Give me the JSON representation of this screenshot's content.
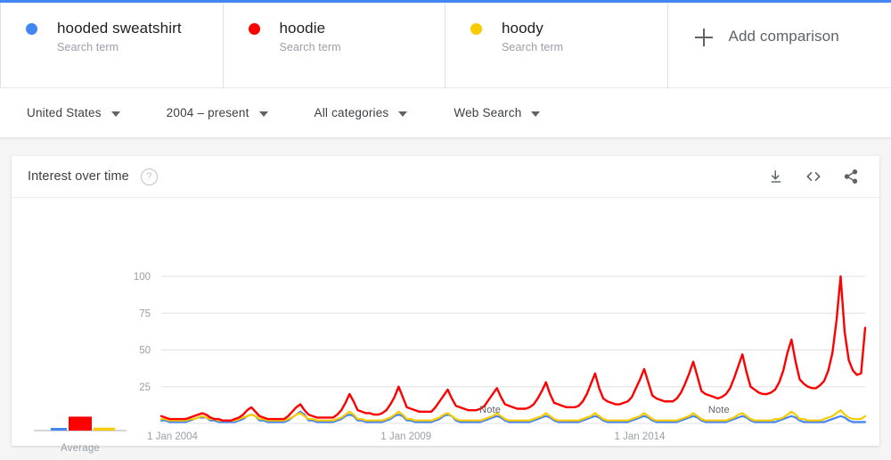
{
  "theme": {
    "accent": "#4285f4",
    "series_colors": [
      "#4285f4",
      "#fe0000",
      "#f8ca00"
    ],
    "page_bg": "#f5f5f5",
    "card_bg": "#ffffff",
    "text_primary": "#202124",
    "text_secondary": "#5f6368",
    "text_muted": "#9aa0a6",
    "grid": "#e0e0e0"
  },
  "terms": [
    {
      "name": "hooded sweatshirt",
      "subtitle": "Search term",
      "color": "#4285f4",
      "dot": "series-dot-blue"
    },
    {
      "name": "hoodie",
      "subtitle": "Search term",
      "color": "#fe0000",
      "dot": "series-dot-red"
    },
    {
      "name": "hoody",
      "subtitle": "Search term",
      "color": "#f8ca00",
      "dot": "series-dot-yellow"
    }
  ],
  "add_comparison": {
    "label": "Add comparison",
    "icon": "plus-icon"
  },
  "filters": [
    {
      "label": "United States",
      "icon": "chevron-down-icon"
    },
    {
      "label": "2004 – present",
      "icon": "chevron-down-icon"
    },
    {
      "label": "All categories",
      "icon": "chevron-down-icon"
    },
    {
      "label": "Web Search",
      "icon": "chevron-down-icon"
    }
  ],
  "card": {
    "title": "Interest over time",
    "help_icon": "help-icon",
    "help_glyph": "?",
    "actions": [
      {
        "name": "download-icon",
        "tooltip": "Download"
      },
      {
        "name": "embed-icon",
        "tooltip": "Embed"
      },
      {
        "name": "share-icon",
        "tooltip": "Share"
      }
    ]
  },
  "average_widget": {
    "label": "Average",
    "values": [
      3,
      24,
      5
    ],
    "colors": [
      "#4285f4",
      "#fe0000",
      "#f8ca00"
    ]
  },
  "annotations": [
    {
      "label": "Note",
      "x_fraction": 0.452
    },
    {
      "label": "Note",
      "x_fraction": 0.777
    }
  ],
  "chart_data": {
    "type": "line",
    "title": "Interest over time",
    "xlabel": "",
    "ylabel": "",
    "ylim": [
      0,
      100
    ],
    "yticks": [
      25,
      50,
      75,
      100
    ],
    "ytick_labels": [
      "25",
      "50",
      "75",
      "100"
    ],
    "xtick_labels": [
      "1 Jan 2004",
      "1 Jan 2009",
      "1 Jan 2014"
    ],
    "xtick_fractions": [
      0.0,
      0.332,
      0.664
    ],
    "grid": true,
    "legend": "top-terms-bar",
    "x_start": "2004-01",
    "x_end": "2018-05",
    "x_interval": "monthly",
    "series": [
      {
        "name": "hooded sweatshirt",
        "color": "#4285f4",
        "values": [
          2,
          2,
          1,
          1,
          1,
          1,
          1,
          2,
          3,
          4,
          4,
          4,
          2,
          2,
          1,
          1,
          1,
          1,
          1,
          2,
          3,
          5,
          6,
          5,
          2,
          2,
          1,
          1,
          1,
          1,
          1,
          2,
          4,
          6,
          8,
          6,
          2,
          2,
          1,
          1,
          1,
          1,
          1,
          2,
          3,
          5,
          6,
          5,
          2,
          2,
          1,
          1,
          1,
          1,
          1,
          2,
          3,
          5,
          6,
          5,
          2,
          2,
          1,
          1,
          1,
          1,
          1,
          2,
          3,
          5,
          6,
          5,
          2,
          1,
          1,
          1,
          1,
          1,
          1,
          2,
          3,
          4,
          5,
          4,
          2,
          1,
          1,
          1,
          1,
          1,
          1,
          2,
          3,
          4,
          5,
          4,
          2,
          1,
          1,
          1,
          1,
          1,
          1,
          2,
          3,
          4,
          5,
          4,
          2,
          1,
          1,
          1,
          1,
          1,
          1,
          2,
          3,
          4,
          5,
          4,
          2,
          1,
          1,
          1,
          1,
          1,
          1,
          2,
          3,
          4,
          5,
          4,
          2,
          1,
          1,
          1,
          1,
          1,
          1,
          2,
          3,
          4,
          5,
          4,
          2,
          1,
          1,
          1,
          1,
          1,
          1,
          2,
          3,
          4,
          5,
          4,
          2,
          1,
          1,
          1,
          1,
          1,
          1,
          2,
          3,
          4,
          5,
          4,
          2,
          1,
          1,
          1,
          1
        ]
      },
      {
        "name": "hoodie",
        "color": "#fe0000",
        "values": [
          5,
          4,
          3,
          3,
          3,
          3,
          3,
          4,
          5,
          6,
          7,
          6,
          4,
          3,
          3,
          2,
          2,
          2,
          3,
          4,
          6,
          9,
          11,
          8,
          5,
          4,
          3,
          3,
          3,
          3,
          3,
          5,
          8,
          11,
          13,
          9,
          6,
          5,
          4,
          4,
          4,
          4,
          4,
          6,
          9,
          14,
          20,
          15,
          9,
          8,
          7,
          7,
          6,
          6,
          7,
          9,
          13,
          18,
          25,
          18,
          11,
          10,
          9,
          8,
          8,
          8,
          8,
          11,
          15,
          19,
          23,
          17,
          12,
          11,
          10,
          9,
          9,
          9,
          10,
          12,
          16,
          20,
          24,
          18,
          13,
          12,
          11,
          10,
          10,
          10,
          11,
          13,
          17,
          22,
          28,
          20,
          14,
          13,
          12,
          11,
          11,
          11,
          12,
          15,
          20,
          27,
          34,
          24,
          17,
          15,
          14,
          13,
          13,
          14,
          15,
          18,
          24,
          30,
          37,
          28,
          19,
          17,
          16,
          15,
          15,
          15,
          17,
          21,
          27,
          34,
          42,
          32,
          22,
          20,
          19,
          18,
          17,
          18,
          20,
          24,
          31,
          39,
          47,
          35,
          25,
          23,
          21,
          20,
          20,
          21,
          23,
          28,
          36,
          48,
          57,
          42,
          30,
          27,
          25,
          24,
          24,
          26,
          29,
          36,
          48,
          70,
          100,
          62,
          43,
          36,
          33,
          34,
          65
        ]
      },
      {
        "name": "hoody",
        "color": "#f8ca00",
        "values": [
          3,
          3,
          2,
          2,
          2,
          2,
          2,
          3,
          3,
          4,
          5,
          4,
          3,
          3,
          2,
          2,
          2,
          2,
          2,
          3,
          4,
          5,
          6,
          5,
          3,
          3,
          2,
          2,
          2,
          2,
          2,
          3,
          4,
          6,
          7,
          5,
          3,
          3,
          2,
          2,
          2,
          2,
          2,
          3,
          4,
          6,
          8,
          6,
          3,
          3,
          2,
          2,
          2,
          2,
          2,
          3,
          4,
          6,
          8,
          6,
          3,
          3,
          2,
          2,
          2,
          2,
          2,
          3,
          4,
          6,
          7,
          5,
          3,
          2,
          2,
          2,
          2,
          2,
          2,
          3,
          4,
          5,
          7,
          5,
          3,
          2,
          2,
          2,
          2,
          2,
          2,
          3,
          4,
          5,
          7,
          5,
          3,
          2,
          2,
          2,
          2,
          2,
          2,
          3,
          4,
          5,
          7,
          5,
          3,
          2,
          2,
          2,
          2,
          2,
          2,
          3,
          4,
          5,
          7,
          5,
          3,
          2,
          2,
          2,
          2,
          2,
          2,
          3,
          4,
          5,
          7,
          5,
          3,
          2,
          2,
          2,
          2,
          2,
          2,
          3,
          4,
          6,
          7,
          5,
          3,
          2,
          2,
          2,
          2,
          2,
          3,
          3,
          4,
          6,
          8,
          6,
          3,
          3,
          2,
          2,
          2,
          2,
          3,
          4,
          5,
          7,
          9,
          6,
          4,
          3,
          3,
          3,
          5
        ]
      }
    ]
  }
}
